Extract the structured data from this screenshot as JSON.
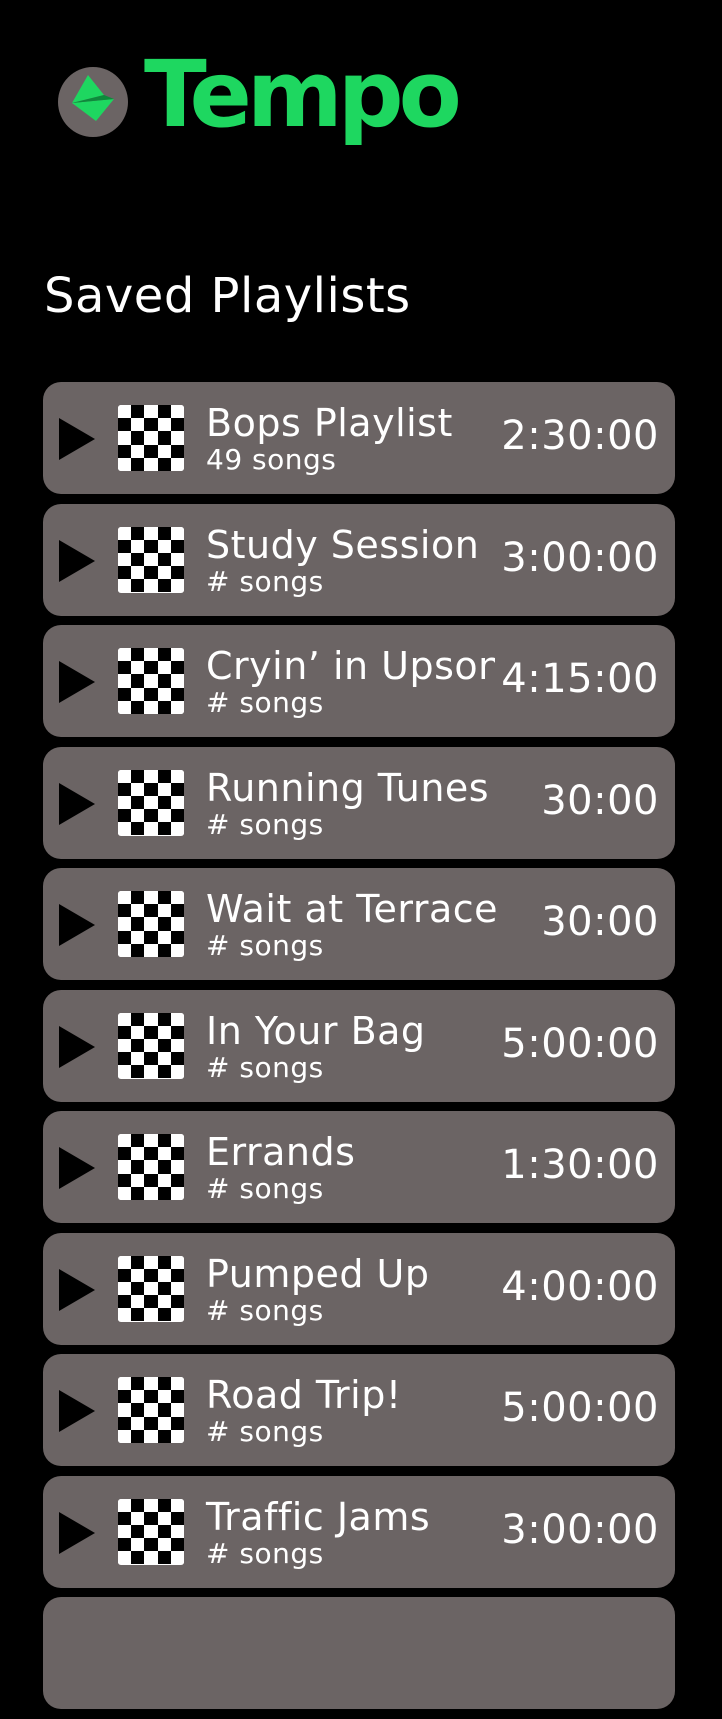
{
  "app": {
    "title": "Tempo",
    "brand_color": "#1ed760",
    "logo_icon": "paper-plane-icon"
  },
  "section": {
    "title": "Saved Playlists"
  },
  "colors": {
    "background": "#000000",
    "card": "#6b6464",
    "text": "#ffffff"
  },
  "playlists": [
    {
      "name": "Bops Playlist",
      "count": "49 songs",
      "duration": "2:30:00"
    },
    {
      "name": "Study Session",
      "count": "# songs",
      "duration": "3:00:00"
    },
    {
      "name": "Cryin’ in Upson",
      "count": "# songs",
      "duration": "4:15:00"
    },
    {
      "name": "Running Tunes",
      "count": "# songs",
      "duration": "30:00"
    },
    {
      "name": "Wait at Terrace",
      "count": "# songs",
      "duration": "30:00"
    },
    {
      "name": "In Your Bag",
      "count": "# songs",
      "duration": "5:00:00"
    },
    {
      "name": "Errands",
      "count": "# songs",
      "duration": "1:30:00"
    },
    {
      "name": "Pumped Up",
      "count": "# songs",
      "duration": "4:00:00"
    },
    {
      "name": "Road Trip!",
      "count": "# songs",
      "duration": "5:00:00"
    },
    {
      "name": "Traffic Jams",
      "count": "# songs",
      "duration": "3:00:00"
    },
    {
      "name": "",
      "count": "",
      "duration": ""
    }
  ]
}
